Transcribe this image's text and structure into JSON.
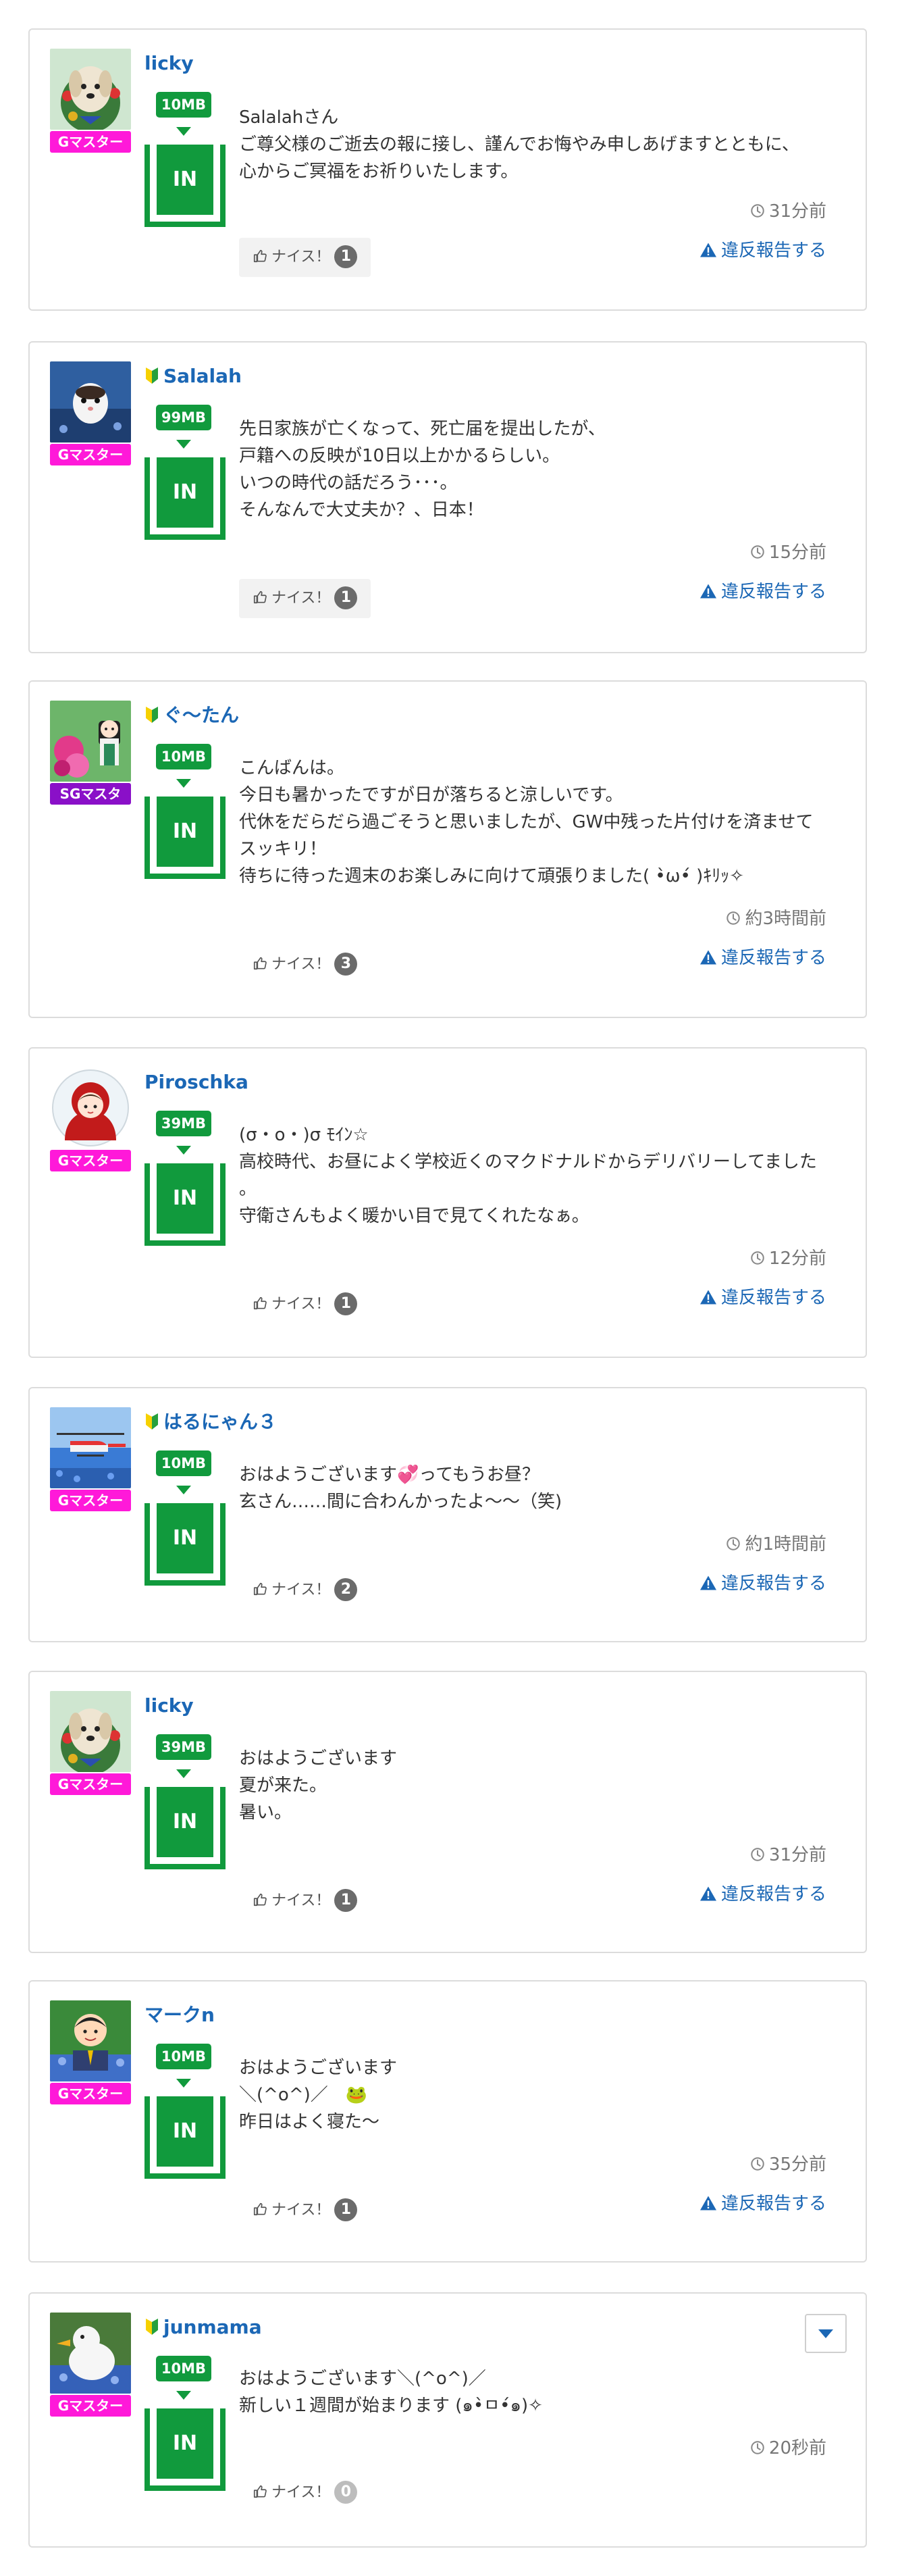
{
  "colors": {
    "username": "#1b67b5",
    "in_green": "#119a3d",
    "rank_g": "#ff19d9",
    "rank_sg": "#8a10c8",
    "report": "#1b67b5"
  },
  "icons": {
    "beginner": "beginner-leaf-icon",
    "clock": "clock-icon",
    "thumb": "thumbs-up-icon",
    "warning": "warning-icon",
    "dropdown": "chevron-down-icon"
  },
  "comments": [
    {
      "username": "licky",
      "beginner": false,
      "rank": "Gマスター",
      "mb": "10MB",
      "in_label": "IN",
      "avatar": "dog-wreath",
      "message": [
        "Salalahさん",
        "ご尊父様のご逝去の報に接し、謹んでお悔やみ申しあげますとともに、",
        "心からご冥福をお祈りいたします。"
      ],
      "time": "31分前",
      "nice_label": "ナイス！",
      "nice_count": "1",
      "nice_bg": true,
      "report_label": "違反報告する"
    },
    {
      "username": "Salalah",
      "beginner": true,
      "rank": "Gマスター",
      "mb": "99MB",
      "in_label": "IN",
      "avatar": "ferret",
      "message": [
        "先日家族が亡くなって、死亡届を提出したが、",
        "戸籍への反映が10日以上かかるらしい。",
        "いつの時代の話だろう･･･。",
        "そんなんで大丈夫か？、日本！"
      ],
      "time": "15分前",
      "nice_label": "ナイス！",
      "nice_count": "1",
      "nice_bg": true,
      "report_label": "違反報告する"
    },
    {
      "username": "ぐ〜たん",
      "beginner": true,
      "rank": "SGマスタ",
      "mb": "10MB",
      "in_label": "IN",
      "avatar": "flower-girl",
      "message": [
        "こんばんは。",
        "今日も暑かったですが日が落ちると涼しいです。",
        "代休をだらだら過ごそうと思いましたが、GW中残った片付けを済ませて",
        "スッキリ！",
        "待ちに待った週末のお楽しみに向けて頑張りました( •̀ω•́ )ｷﾘｯ✧"
      ],
      "time": "約3時間前",
      "nice_label": "ナイス！",
      "nice_count": "3",
      "nice_bg": false,
      "report_label": "違反報告する"
    },
    {
      "username": "Piroschka",
      "beginner": false,
      "rank": "Gマスター",
      "mb": "39MB",
      "in_label": "IN",
      "avatar": "red-hood",
      "message": [
        "(σ・o・)σ ﾓｲﾝ☆",
        "高校時代、お昼によく学校近くのマクドナルドからデリバリーしてました",
        "。",
        "守衛さんもよく暖かい目で見てくれたなぁ。"
      ],
      "time": "12分前",
      "nice_label": "ナイス！",
      "nice_count": "1",
      "nice_bg": false,
      "report_label": "違反報告する"
    },
    {
      "username": "はるにゃん３",
      "beginner": true,
      "rank": "Gマスター",
      "mb": "10MB",
      "in_label": "IN",
      "avatar": "helicopter",
      "message": [
        "おはようございます💞ってもうお昼？",
        "玄さん……間に合わんかったよ〜〜（笑)"
      ],
      "time": "約1時間前",
      "nice_label": "ナイス！",
      "nice_count": "2",
      "nice_bg": false,
      "report_label": "違反報告する"
    },
    {
      "username": "licky",
      "beginner": false,
      "rank": "Gマスター",
      "mb": "39MB",
      "in_label": "IN",
      "avatar": "dog-wreath",
      "message": [
        "おはようございます",
        "夏が来た。",
        "暑い。"
      ],
      "time": "31分前",
      "nice_label": "ナイス！",
      "nice_count": "1",
      "nice_bg": false,
      "report_label": "違反報告する"
    },
    {
      "username": "マークn",
      "beginner": false,
      "rank": "Gマスター",
      "mb": "10MB",
      "in_label": "IN",
      "avatar": "man-flowers",
      "message": [
        "おはようございます",
        "＼(^o^)／　🐸",
        "昨日はよく寝た〜"
      ],
      "time": "35分前",
      "nice_label": "ナイス！",
      "nice_count": "1",
      "nice_bg": false,
      "report_label": "違反報告する"
    },
    {
      "username": "junmama",
      "beginner": true,
      "rank": "Gマスター",
      "mb": "10MB",
      "in_label": "IN",
      "avatar": "duck",
      "message": [
        "おはようございます＼(^o^)／",
        "新しい１週間が始まります (๑•̀ㅁ•́๑)✧"
      ],
      "time": "20秒前",
      "nice_label": "ナイス！",
      "nice_count": "0",
      "nice_bg": false,
      "report_label": null,
      "has_menu": true
    }
  ]
}
